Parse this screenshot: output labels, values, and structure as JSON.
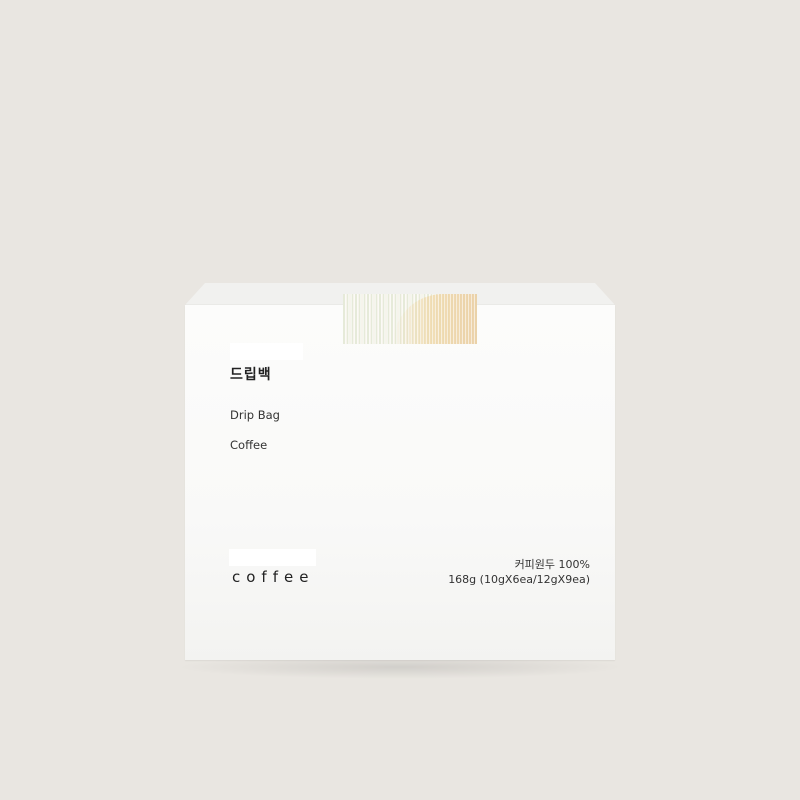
{
  "colors": {
    "background": "#e9e6e1",
    "box": "#fbfbfa",
    "text": "#222222"
  },
  "package": {
    "name_korean": "드립백",
    "name_english_line1": "Drip Bag",
    "name_english_line2": "Coffee",
    "brand_word": "coffee",
    "spec_line1": "커피원두 100%",
    "spec_line2": "168g (10gX6ea/12gX9ea)"
  }
}
